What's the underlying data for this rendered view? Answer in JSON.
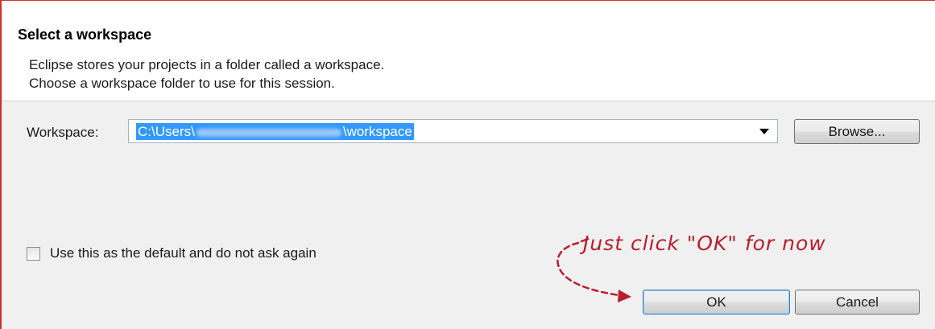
{
  "dialog": {
    "title": "Select a workspace",
    "description_line1": "Eclipse stores your projects in a folder called a workspace.",
    "description_line2": "Choose a workspace folder to use for this session."
  },
  "workspace": {
    "label": "Workspace:",
    "value_prefix": "C:\\Users\\",
    "value_suffix": "\\workspace",
    "browse_label": "Browse..."
  },
  "default_checkbox": {
    "label": "Use this as the default and do not ask again",
    "checked": false
  },
  "annotation": {
    "text": "Just click \"OK\" for now",
    "color": "#b51f2e"
  },
  "buttons": {
    "ok_label": "OK",
    "cancel_label": "Cancel"
  },
  "colors": {
    "selection": "#3399ff",
    "frame_border": "#c9302c"
  }
}
